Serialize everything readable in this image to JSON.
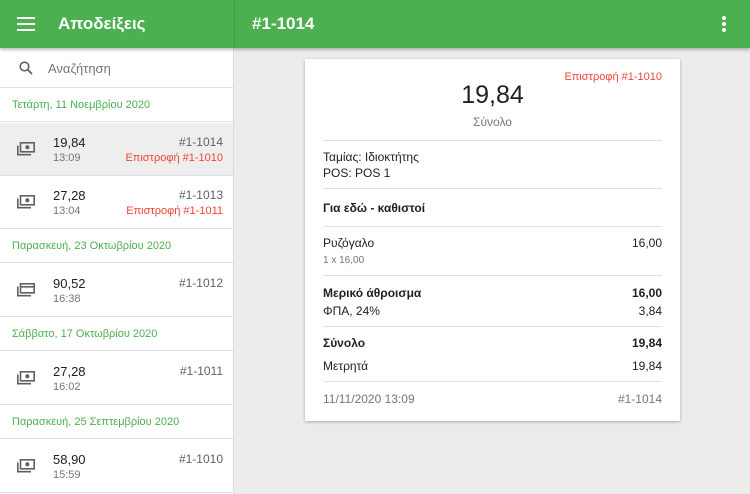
{
  "appbar": {
    "title": "Αποδείξεις",
    "receipt_title": "#1-1014",
    "menu_icon": "menu-icon",
    "more_icon": "more-vert-icon",
    "color": "#4caf50"
  },
  "search": {
    "placeholder": "Αναζήτηση",
    "icon": "search-icon"
  },
  "groups": [
    {
      "date": "Τετάρτη, 11 Νοεμβρίου 2020",
      "receipts": [
        {
          "amount": "19,84",
          "time": "13:09",
          "number": "#1-1014",
          "refund": "Επιστροφή #1-1010",
          "icon": "cash-icon",
          "selected": true
        },
        {
          "amount": "27,28",
          "time": "13:04",
          "number": "#1-1013",
          "refund": "Επιστροφή #1-1011",
          "icon": "cash-icon"
        }
      ]
    },
    {
      "date": "Παρασκευή, 23 Οκτωβρίου 2020",
      "receipts": [
        {
          "amount": "90,52",
          "time": "16:38",
          "number": "#1-1012",
          "icon": "card-icon"
        }
      ]
    },
    {
      "date": "Σάββατο, 17 Οκτωβρίου 2020",
      "receipts": [
        {
          "amount": "27,28",
          "time": "16:02",
          "number": "#1-1011",
          "icon": "cash-icon"
        }
      ]
    },
    {
      "date": "Παρασκευή, 25 Σεπτεμβρίου 2020",
      "receipts": [
        {
          "amount": "58,90",
          "time": "15:59",
          "number": "#1-1010",
          "icon": "cash-icon"
        }
      ]
    }
  ],
  "receipt": {
    "refund_label": "Επιστροφή #1-1010",
    "total": "19,84",
    "total_caption": "Σύνολο",
    "cashier": "Ταμίας: Ιδιοκτήτης",
    "pos": "POS: POS 1",
    "dining": "Για εδώ - καθιστοί",
    "item_name": "Ρυζόγαλο",
    "item_qty": "1 x 16,00",
    "item_price": "16,00",
    "subtotal_label": "Μερικό άθροισμα",
    "subtotal_value": "16,00",
    "tax_label": "ΦΠΑ, 24%",
    "tax_value": "3,84",
    "total_label": "Σύνολο",
    "total_value": "19,84",
    "payment_label": "Μετρητά",
    "payment_value": "19,84",
    "datetime": "11/11/2020 13:09",
    "number": "#1-1014"
  }
}
